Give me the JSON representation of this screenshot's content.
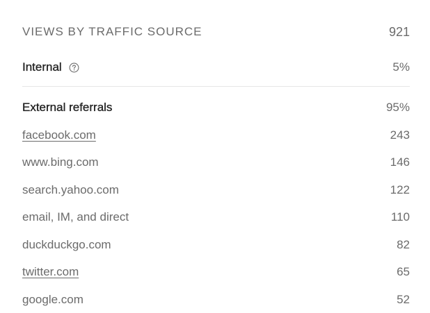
{
  "header": {
    "title": "VIEWS BY TRAFFIC SOURCE",
    "total": "921"
  },
  "internal": {
    "label": "Internal",
    "value": "5%",
    "help_icon": "question-circle-icon"
  },
  "external": {
    "label": "External referrals",
    "value": "95%"
  },
  "sources": [
    {
      "label": "facebook.com",
      "value": "243",
      "link": true
    },
    {
      "label": "www.bing.com",
      "value": "146",
      "link": false
    },
    {
      "label": "search.yahoo.com",
      "value": "122",
      "link": false
    },
    {
      "label": "email, IM, and direct",
      "value": "110",
      "link": false
    },
    {
      "label": "duckduckgo.com",
      "value": "82",
      "link": false
    },
    {
      "label": "twitter.com",
      "value": "65",
      "link": true
    },
    {
      "label": "google.com",
      "value": "52",
      "link": false
    }
  ],
  "colors": {
    "primary_text": "#242424",
    "secondary_text": "#6b6b6b",
    "divider": "#e6e6e6"
  }
}
